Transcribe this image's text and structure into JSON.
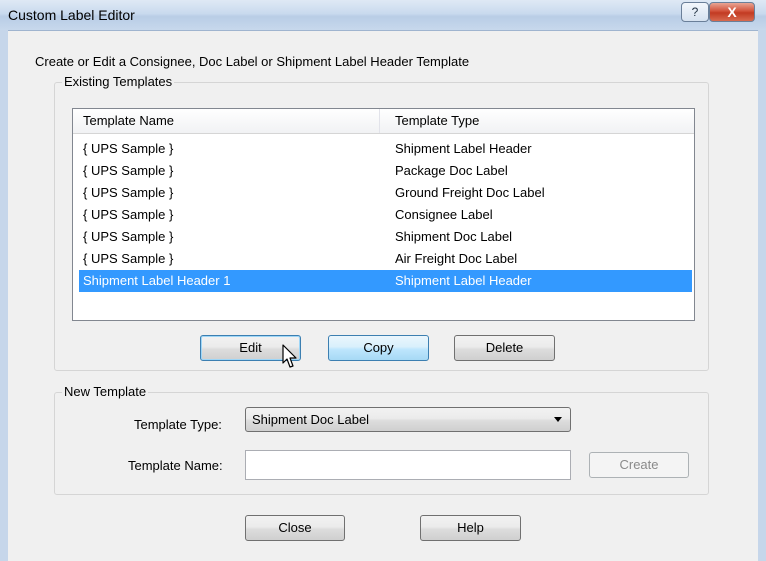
{
  "window": {
    "title": "Custom Label Editor",
    "help_glyph": "?",
    "close_glyph": "X"
  },
  "description": "Create or Edit a Consignee, Doc Label or Shipment Label Header Template",
  "existing": {
    "group_label": "Existing Templates",
    "columns": [
      "Template Name",
      "Template Type"
    ],
    "rows": [
      {
        "name": "{ UPS Sample }",
        "type": "Shipment Label Header"
      },
      {
        "name": "{ UPS Sample }",
        "type": "Package Doc Label"
      },
      {
        "name": "{ UPS Sample }",
        "type": "Ground Freight Doc Label"
      },
      {
        "name": "{ UPS Sample }",
        "type": "Consignee Label"
      },
      {
        "name": "{ UPS Sample }",
        "type": "Shipment Doc Label"
      },
      {
        "name": "{ UPS Sample }",
        "type": "Air Freight Doc Label"
      },
      {
        "name": "Shipment Label Header 1",
        "type": "Shipment Label Header",
        "selected": true
      }
    ],
    "buttons": {
      "edit": "Edit",
      "copy": "Copy",
      "delete": "Delete"
    }
  },
  "new_template": {
    "group_label": "New Template",
    "type_label": "Template Type:",
    "type_value": "Shipment Doc Label",
    "name_label": "Template Name:",
    "name_value": "",
    "create_label": "Create"
  },
  "footer": {
    "close_label": "Close",
    "help_label": "Help"
  },
  "colors": {
    "selection": "#3399ff",
    "dialog_bg": "#f0f0f0",
    "titlebar": "#c9daee"
  }
}
